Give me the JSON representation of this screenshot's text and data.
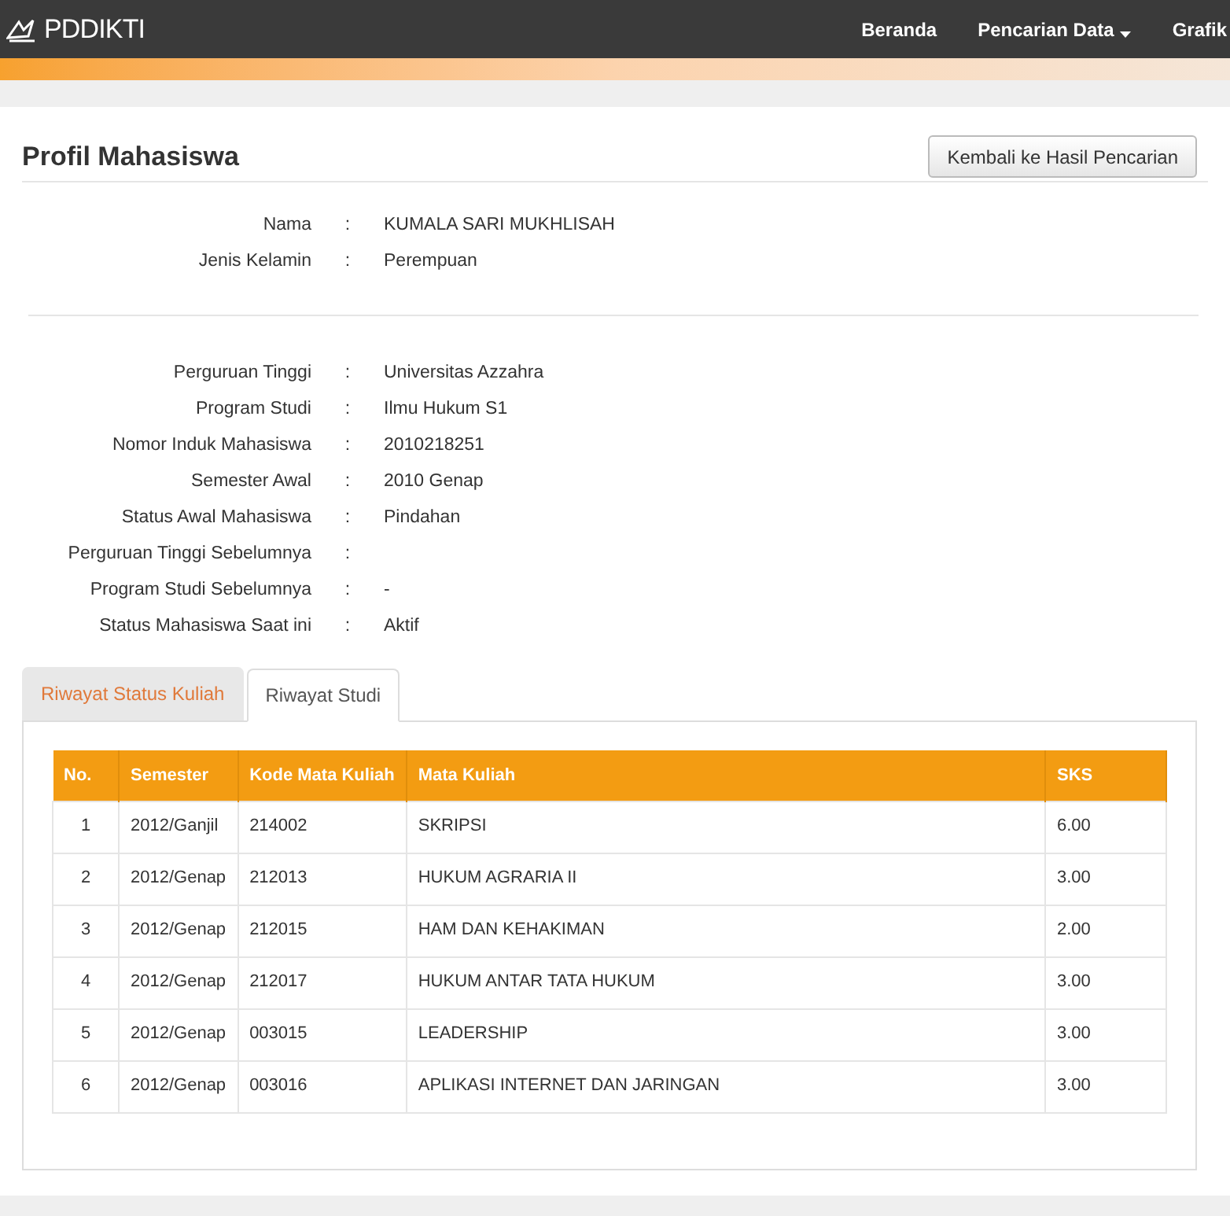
{
  "navbar": {
    "brand": "PDDIKTI",
    "links": [
      {
        "label": "Beranda",
        "dropdown": false
      },
      {
        "label": "Pencarian Data",
        "dropdown": true
      },
      {
        "label": "Grafik",
        "dropdown": false
      }
    ]
  },
  "profile": {
    "title": "Profil Mahasiswa",
    "back_button": "Kembali ke Hasil Pencarian",
    "groups": [
      [
        {
          "label": "Nama",
          "separator": ":",
          "value": "KUMALA SARI MUKHLISAH"
        },
        {
          "label": "Jenis Kelamin",
          "separator": ":",
          "value": "Perempuan"
        }
      ],
      [
        {
          "label": "Perguruan Tinggi",
          "separator": ":",
          "value": "Universitas Azzahra"
        },
        {
          "label": "Program Studi",
          "separator": ":",
          "value": "Ilmu Hukum S1"
        },
        {
          "label": "Nomor Induk Mahasiswa",
          "separator": ":",
          "value": "2010218251"
        },
        {
          "label": "Semester Awal",
          "separator": ":",
          "value": "2010 Genap"
        },
        {
          "label": "Status Awal Mahasiswa",
          "separator": ":",
          "value": "Pindahan"
        },
        {
          "label": "Perguruan Tinggi Sebelumnya",
          "separator": ":"
        },
        {
          "label": "Program Studi Sebelumnya",
          "separator": ":",
          "value": "-"
        },
        {
          "label": "Status Mahasiswa Saat ini",
          "separator": ":",
          "value": "Aktif"
        }
      ]
    ]
  },
  "tabs": [
    {
      "label": "Riwayat Status Kuliah",
      "selected": false
    },
    {
      "label": "Riwayat Studi",
      "selected": true
    }
  ],
  "table": {
    "columns": [
      "No.",
      "Semester",
      "Kode Mata Kuliah",
      "Mata Kuliah",
      "SKS"
    ],
    "rows": [
      [
        "1",
        "2012/Ganjil",
        "214002",
        "SKRIPSI",
        "6.00"
      ],
      [
        "2",
        "2012/Genap",
        "212013",
        "HUKUM AGRARIA II",
        "3.00"
      ],
      [
        "3",
        "2012/Genap",
        "212015",
        "HAM DAN KEHAKIMAN",
        "2.00"
      ],
      [
        "4",
        "2012/Genap",
        "212017",
        "HUKUM ANTAR TATA HUKUM",
        "3.00"
      ],
      [
        "5",
        "2012/Genap",
        "003015",
        "LEADERSHIP",
        "3.00"
      ],
      [
        "6",
        "2012/Genap",
        "003016",
        "APLIKASI INTERNET DAN JARINGAN",
        "3.00"
      ]
    ]
  }
}
